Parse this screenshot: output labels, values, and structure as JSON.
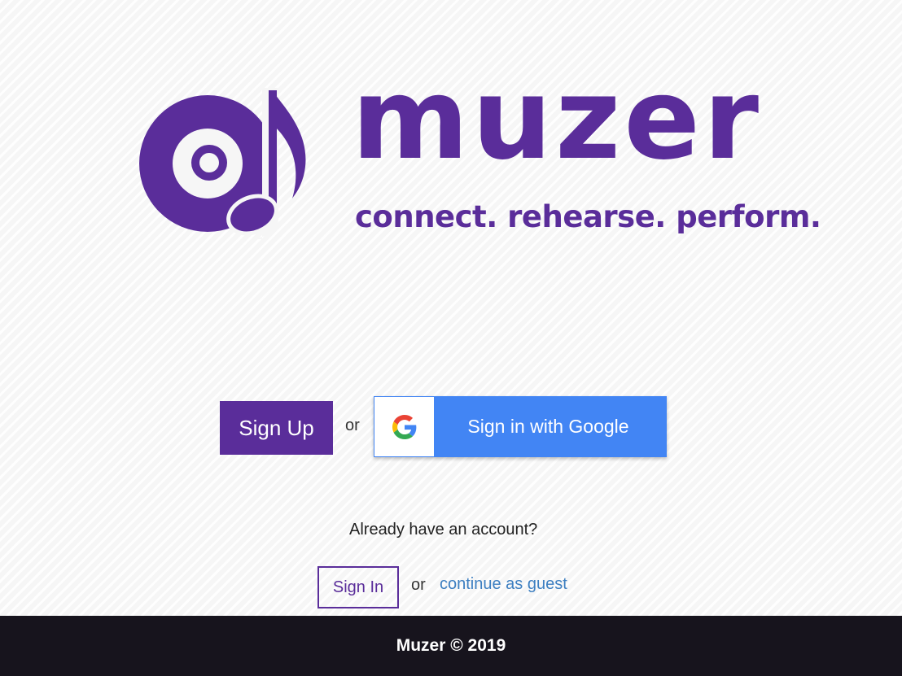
{
  "brand": {
    "name": "muzer",
    "tagline": "connect. rehearse. perform.",
    "color": "#5a2d9a",
    "logo_icon": "vinyl-record-music-note-icon"
  },
  "auth": {
    "signup_label": "Sign Up",
    "or_label": "or",
    "google_label": "Sign in with Google",
    "google_color": "#4285f4",
    "google_icon": "google-g-icon",
    "already_prompt": "Already have an account?",
    "signin_label": "Sign In",
    "or_label_2": "or",
    "guest_label": "continue as guest",
    "guest_color": "#3d7fc1"
  },
  "footer": {
    "text": "Muzer © 2019",
    "background": "#17141d"
  }
}
